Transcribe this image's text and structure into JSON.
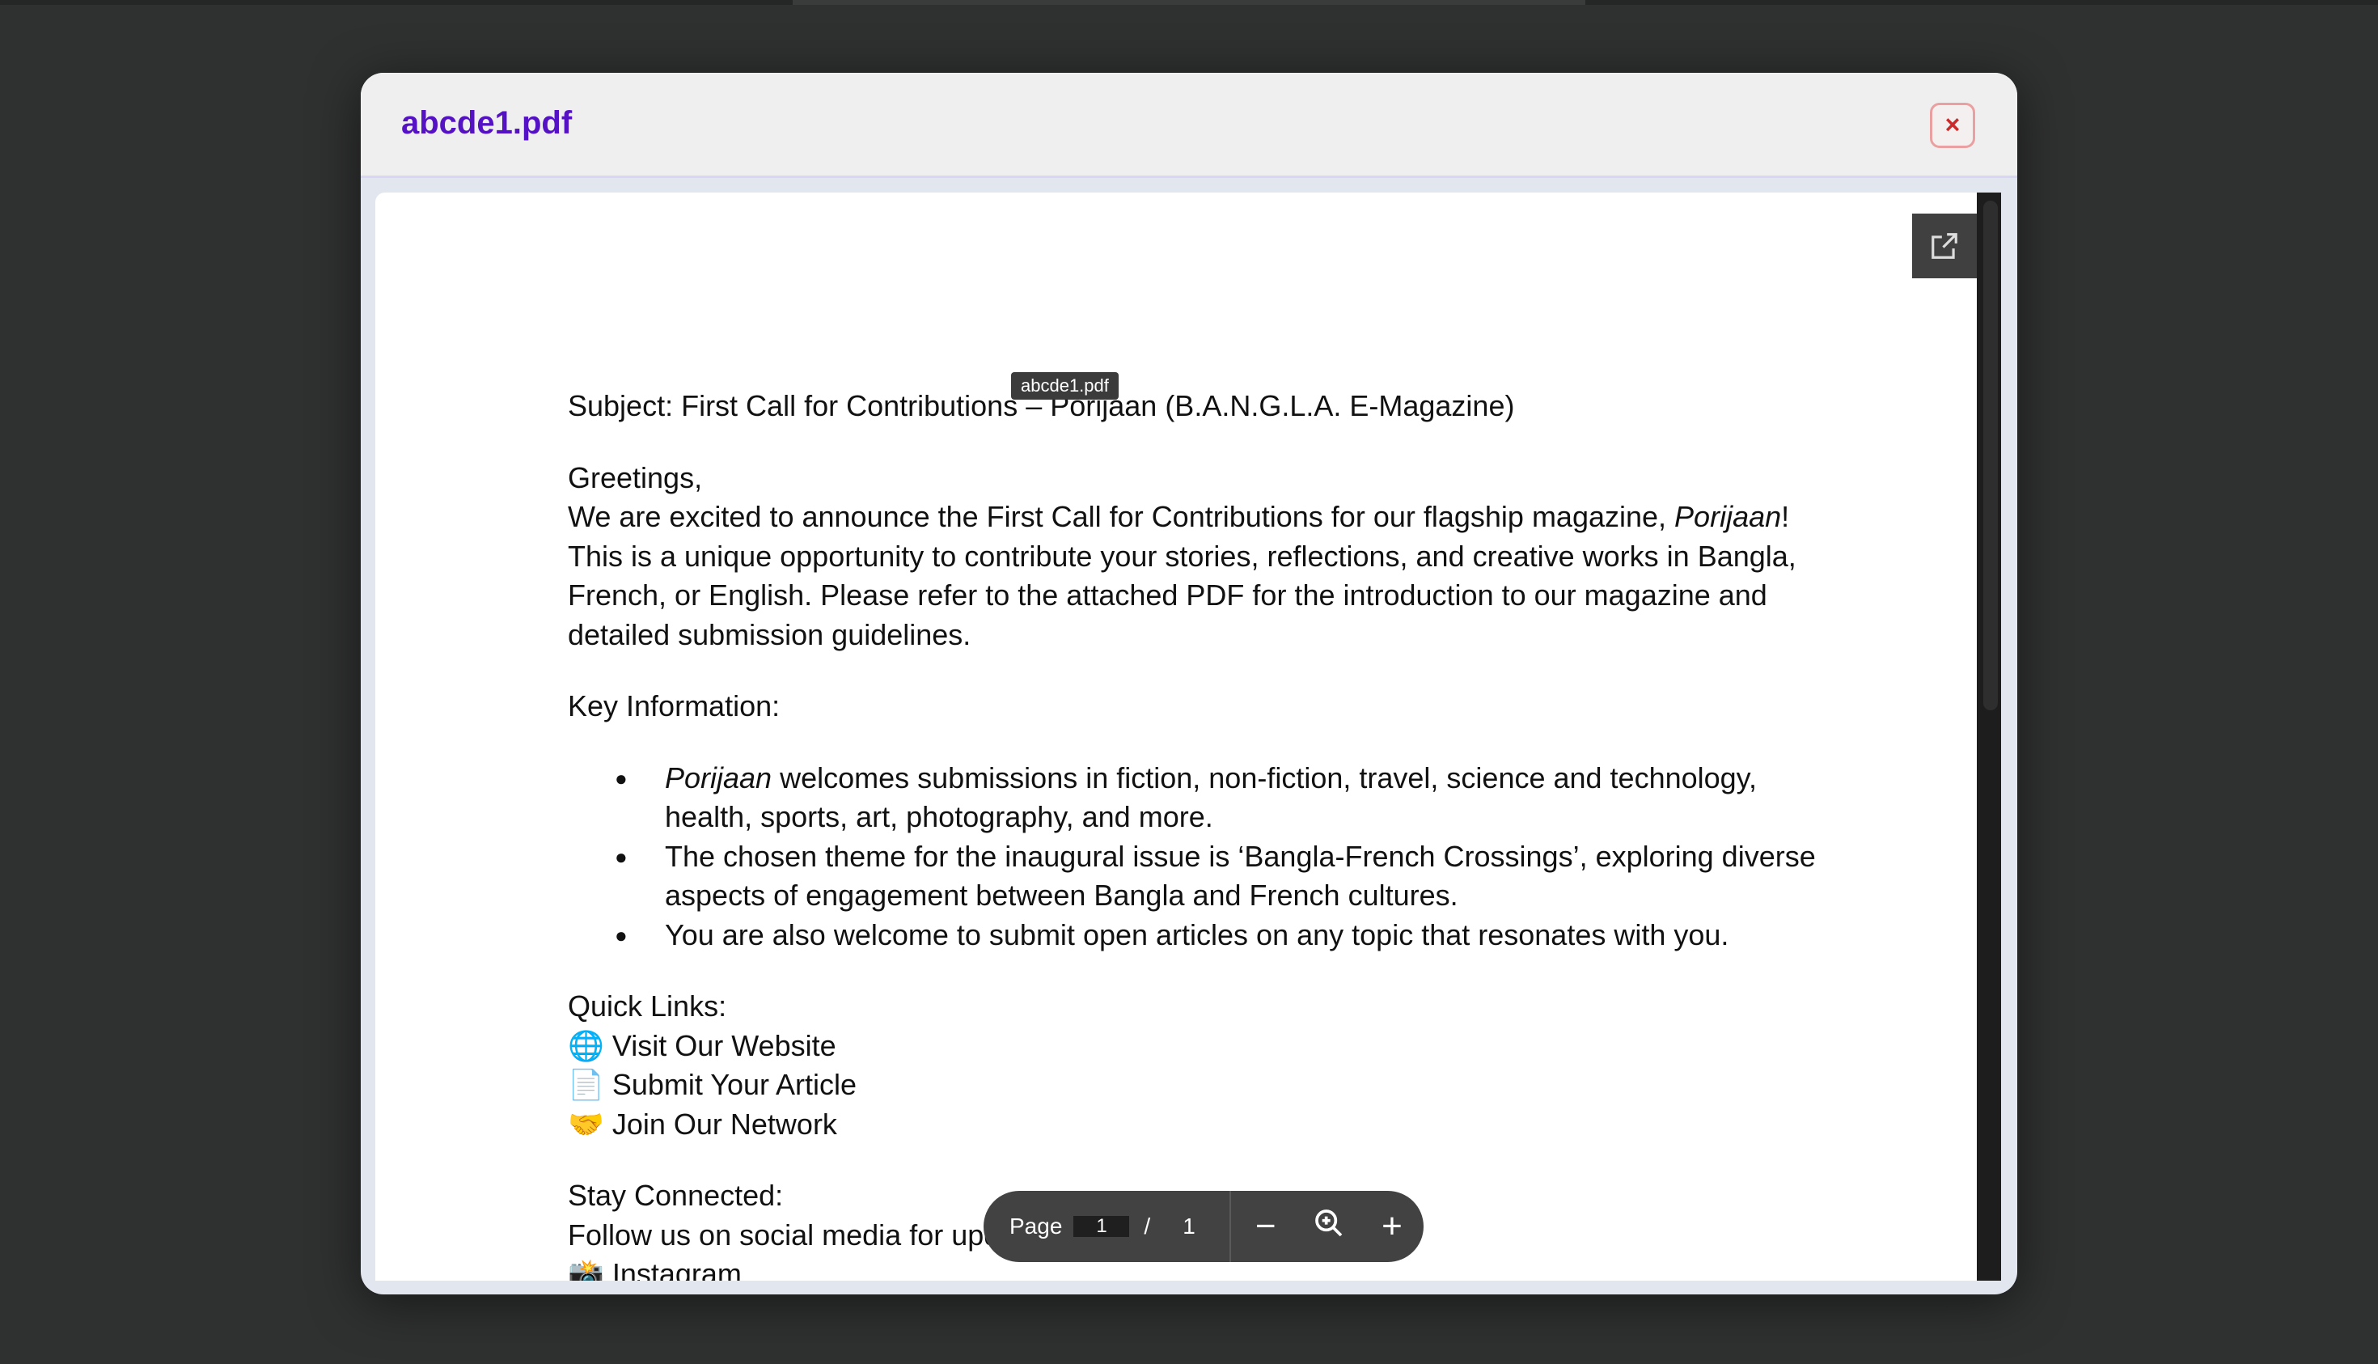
{
  "modal": {
    "title": "abcde1.pdf",
    "close_label": "×"
  },
  "viewer": {
    "tooltip": "abcde1.pdf",
    "subject": "Subject: First Call for Contributions – Porijaan (B.A.N.G.L.A. E-Magazine)",
    "greeting": "Greetings,",
    "intro_italic": "Porijaan",
    "intro_a": "We are excited to announce the First Call for Contributions for our flagship magazine, ",
    "intro_b": "! This is a unique opportunity to contribute your stories, reflections, and creative works in Bangla, French, or English. Please refer to the attached PDF for the introduction to our magazine and detailed submission guidelines.",
    "key_heading": "Key Information:",
    "bullet1_italic": "Porijaan",
    "bullet1": " welcomes submissions in fiction, non-fiction, travel, science and technology, health, sports, art, photography, and more.",
    "bullet2": "The chosen theme for the inaugural issue is ‘Bangla-French Crossings’, exploring diverse aspects of engagement between Bangla and French cultures.",
    "bullet3": "You are also welcome to submit open articles on any topic that resonates with you.",
    "quick_heading": "Quick Links:",
    "links": [
      {
        "icon": "🌐",
        "label": "Visit Our Website"
      },
      {
        "icon": "📄",
        "label": "Submit Your Article"
      },
      {
        "icon": "🤝",
        "label": "Join Our Network"
      }
    ],
    "stay_heading": "Stay Connected:",
    "follow": "Follow us on social media for updates:",
    "instagram_icon": "📸",
    "instagram": "Instagram"
  },
  "toolbar": {
    "page_label": "Page",
    "page_value": "1",
    "separator": "/",
    "page_total": "1",
    "zoom_out": "−",
    "zoom_in": "+"
  }
}
